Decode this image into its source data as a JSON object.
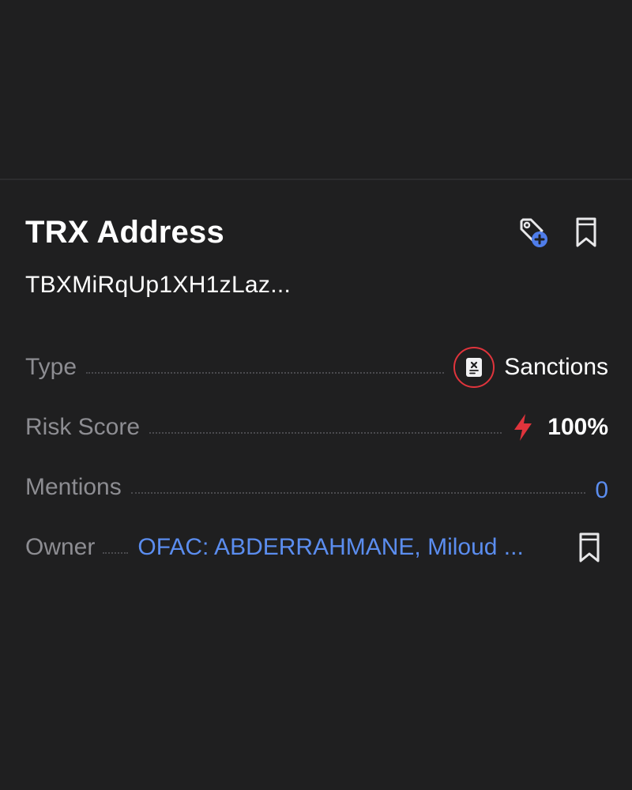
{
  "header": {
    "title": "TRX Address",
    "address": "TBXMiRqUp1XH1zLaz..."
  },
  "icons": {
    "add_tag": "tag-add-icon",
    "bookmark": "bookmark-icon",
    "sanctions": "sanctions-document-icon",
    "risk": "lightning-bolt-icon"
  },
  "details": {
    "type": {
      "label": "Type",
      "value": "Sanctions"
    },
    "risk_score": {
      "label": "Risk Score",
      "value": "100%"
    },
    "mentions": {
      "label": "Mentions",
      "value": "0"
    },
    "owner": {
      "label": "Owner",
      "value": "OFAC: ABDERRAHMANE, Miloud ..."
    }
  },
  "colors": {
    "background": "#1f1f20",
    "link": "#5b8def",
    "danger": "#e0343c",
    "label": "#8d8d92"
  }
}
